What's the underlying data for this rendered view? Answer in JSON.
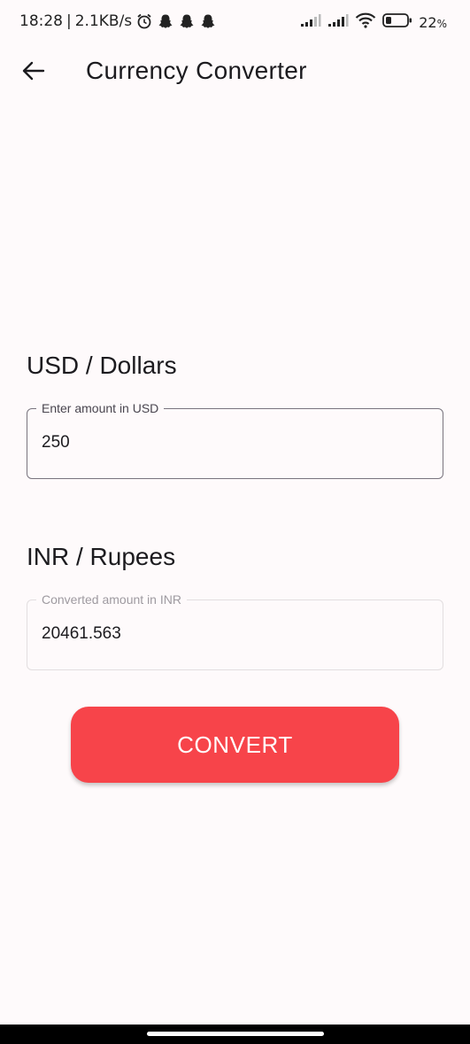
{
  "status_bar": {
    "time": "18:28",
    "separator": "|",
    "speed": "2.1KB/s",
    "battery": "22",
    "battery_unit": "%"
  },
  "app_bar": {
    "title": "Currency Converter"
  },
  "usd_section": {
    "heading": "USD / Dollars",
    "field_label": "Enter amount in USD",
    "field_value": "250"
  },
  "inr_section": {
    "heading": "INR / Rupees",
    "field_label": "Converted amount in INR",
    "field_value": "20461.563"
  },
  "convert_button": {
    "label": "CONVERT"
  },
  "icons": {
    "back": "arrow-left-icon",
    "alarm": "alarm-icon",
    "notifications": "snapchat-ghost-icon",
    "signal": "cellular-signal-icon",
    "wifi": "wifi-icon",
    "battery": "battery-icon"
  },
  "colors": {
    "accent": "#F7444A",
    "background": "#FEFAFB",
    "text": "#1C1B1F"
  }
}
